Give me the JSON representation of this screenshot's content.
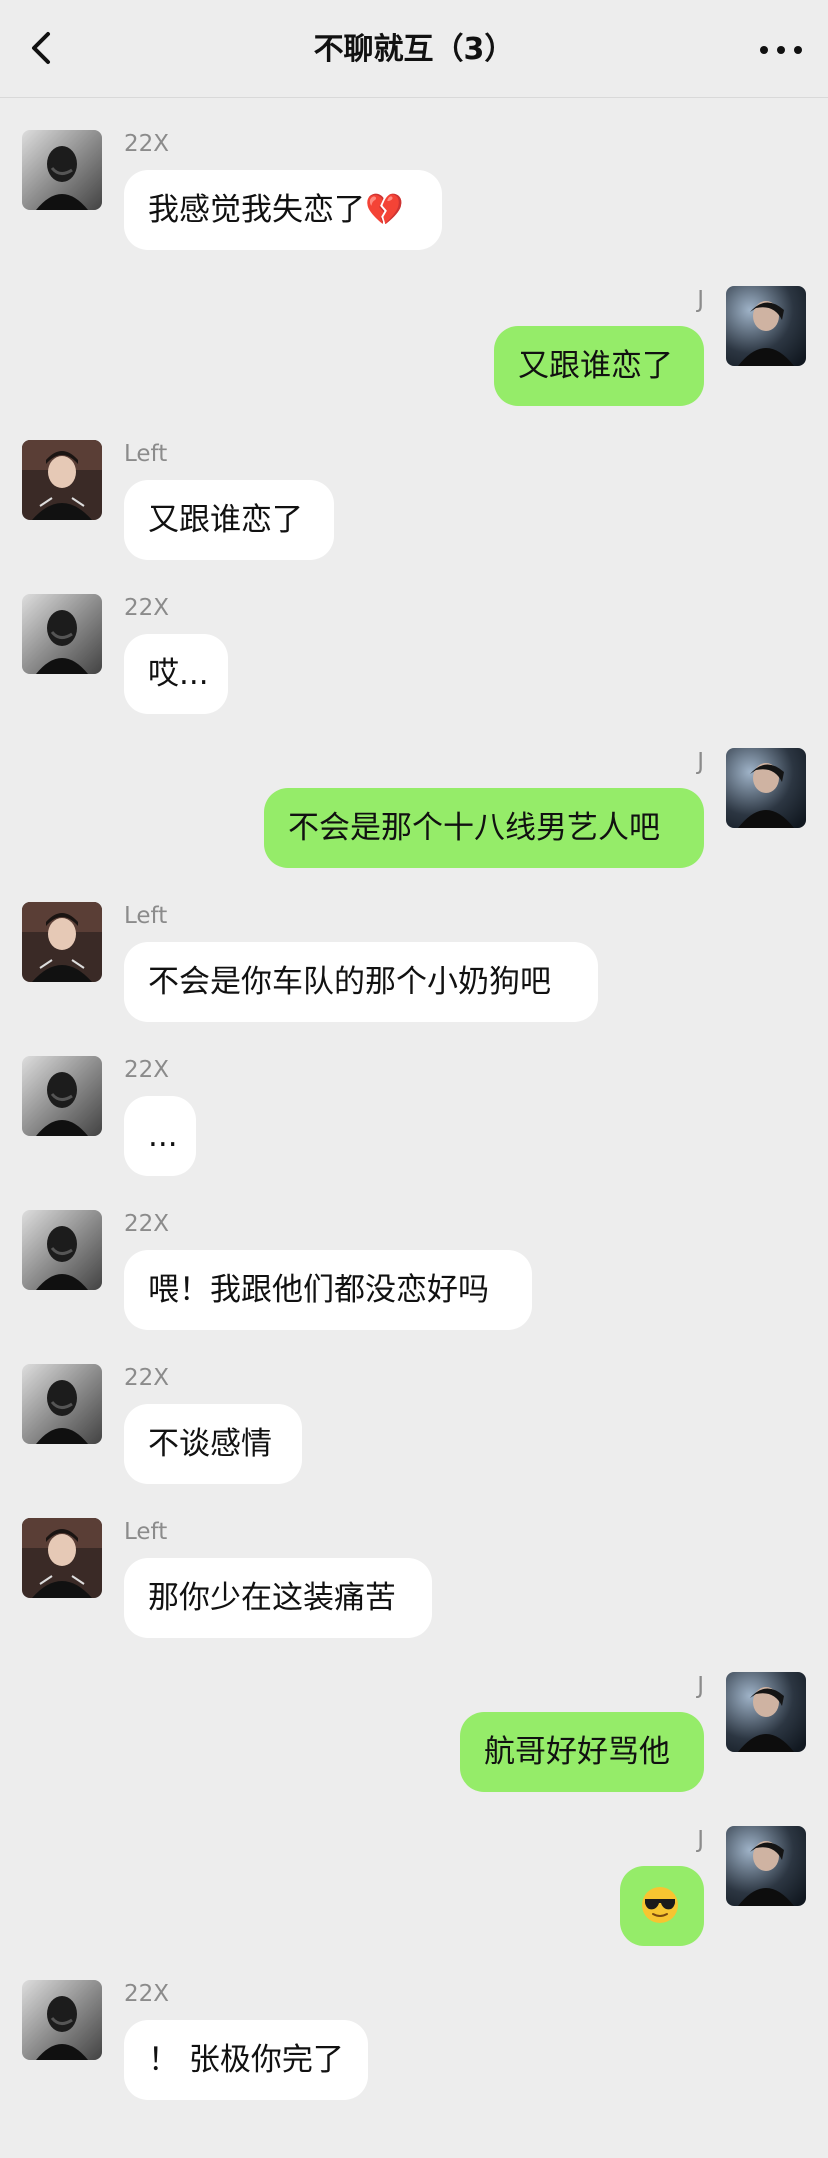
{
  "header": {
    "title": "不聊就互（3）"
  },
  "messages": [
    {
      "side": "left",
      "sender": "22X",
      "avatar": "avatar-22x",
      "text": "我感觉我失恋了💔"
    },
    {
      "side": "right",
      "sender": "J",
      "avatar": "avatar-j",
      "text": "又跟谁恋了"
    },
    {
      "side": "left",
      "sender": "Left",
      "avatar": "avatar-left",
      "text": "又跟谁恋了"
    },
    {
      "side": "left",
      "sender": "22X",
      "avatar": "avatar-22x",
      "text": "哎..."
    },
    {
      "side": "right",
      "sender": "J",
      "avatar": "avatar-j",
      "text": "不会是那个十八线男艺人吧"
    },
    {
      "side": "left",
      "sender": "Left",
      "avatar": "avatar-left",
      "text": "不会是你车队的那个小奶狗吧"
    },
    {
      "side": "left",
      "sender": "22X",
      "avatar": "avatar-22x",
      "text": "..."
    },
    {
      "side": "left",
      "sender": "22X",
      "avatar": "avatar-22x",
      "text": "喂！我跟他们都没恋好吗"
    },
    {
      "side": "left",
      "sender": "22X",
      "avatar": "avatar-22x",
      "text": "不谈感情"
    },
    {
      "side": "left",
      "sender": "Left",
      "avatar": "avatar-left",
      "text": "那你少在这装痛苦"
    },
    {
      "side": "right",
      "sender": "J",
      "avatar": "avatar-j",
      "text": "航哥好好骂他"
    },
    {
      "side": "right",
      "sender": "J",
      "avatar": "avatar-j",
      "text": "",
      "emoji": "sunglasses-emoji"
    },
    {
      "side": "left",
      "sender": "22X",
      "avatar": "avatar-22x",
      "text": "！ 张极你完了"
    }
  ],
  "colors": {
    "background": "#ededed",
    "incoming_bubble": "#ffffff",
    "outgoing_bubble": "#95ec69",
    "sender_name": "#8b8b8b"
  }
}
